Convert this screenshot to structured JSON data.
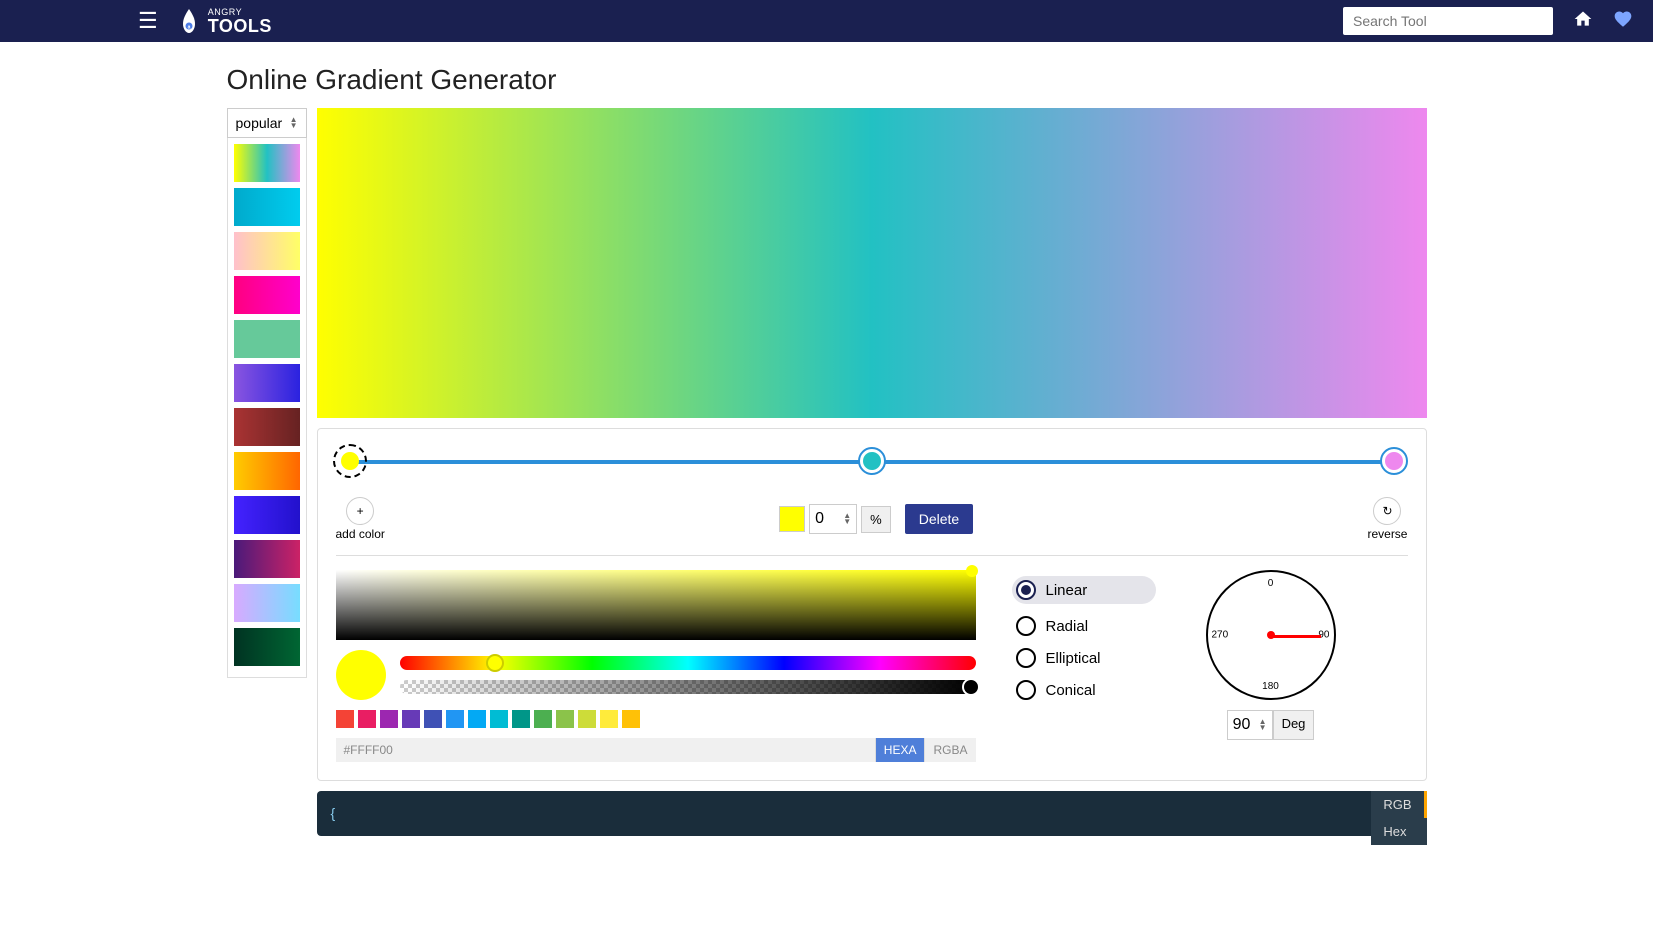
{
  "header": {
    "brand_top": "ANGRY",
    "brand_bottom": "TOOLS",
    "search_placeholder": "Search Tool"
  },
  "page": {
    "title": "Online Gradient Generator"
  },
  "sidebar": {
    "select_label": "popular",
    "presets": [
      "linear-gradient(to right, #ffff00, #22c1c3, #ee88ee)",
      "linear-gradient(to right, #00aacc, #00ccee)",
      "linear-gradient(to right, #ffc0cb, #ffff66)",
      "linear-gradient(to right, #ff0080, #ff00cc)",
      "linear-gradient(to right, #66c99a, #66c99a)",
      "linear-gradient(to right, #8a55e0, #2a22e0)",
      "linear-gradient(to right, #aa3333, #662222)",
      "linear-gradient(to right, #ffcc00, #ff6600)",
      "linear-gradient(to right, #4422ff, #2211cc)",
      "linear-gradient(to right, #4a1a7a, #cc2266)",
      "linear-gradient(to right, #d8aaff, #77ddff)",
      "linear-gradient(to right, #003322, #006633)"
    ]
  },
  "gradient": {
    "css": "linear-gradient(90deg, #ffff00 0%, #22c1c3 50%, #ee88ee 100%)",
    "stops": [
      {
        "color": "#ffff00",
        "pos": 0,
        "selected": true
      },
      {
        "color": "#22c1c3",
        "pos": 50,
        "selected": false
      },
      {
        "color": "#ee88ee",
        "pos": 100,
        "selected": false
      }
    ]
  },
  "stop_controls": {
    "add_label": "add color",
    "add_icon": "+",
    "position": "0",
    "unit": "%",
    "delete": "Delete",
    "reverse": "reverse",
    "reverse_icon": "↻",
    "current_color": "#ffff00"
  },
  "picker": {
    "hex": "#FFFF00",
    "fmt_hexa": "HEXA",
    "fmt_rgba": "RGBA",
    "swatches": [
      "#F44336",
      "#E91E63",
      "#9C27B0",
      "#673AB7",
      "#3F51B5",
      "#2196F3",
      "#03A9F4",
      "#00BCD4",
      "#009688",
      "#4CAF50",
      "#8BC34A",
      "#CDDC39",
      "#FFEB3B",
      "#FFC107"
    ]
  },
  "types": {
    "options": [
      "Linear",
      "Radial",
      "Elliptical",
      "Conical"
    ],
    "selected": "Linear"
  },
  "angle": {
    "value": "90",
    "unit": "Deg",
    "ticks": {
      "t0": "0",
      "t90": "90",
      "t180": "180",
      "t270": "270"
    }
  },
  "code": {
    "open": "{",
    "tabs": [
      "RGB",
      "Hex"
    ],
    "active": "RGB"
  }
}
